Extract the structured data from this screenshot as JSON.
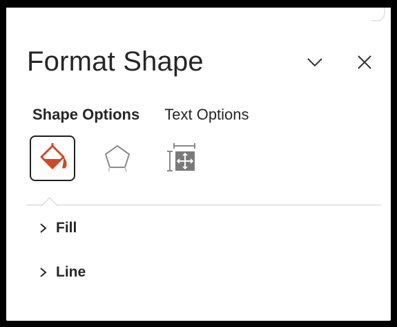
{
  "pane": {
    "title": "Format Shape",
    "icons": {
      "collapse": "chevron-down-icon",
      "close": "close-icon"
    }
  },
  "tabs": [
    {
      "label": "Shape Options",
      "active": true
    },
    {
      "label": "Text Options",
      "active": false
    }
  ],
  "icon_tabs": [
    {
      "name": "fill-line-icon",
      "selected": true
    },
    {
      "name": "effects-icon",
      "selected": false
    },
    {
      "name": "size-properties-icon",
      "selected": false
    }
  ],
  "sections": [
    {
      "label": "Fill",
      "icon": "chevron-right-icon"
    },
    {
      "label": "Line",
      "icon": "chevron-right-icon"
    }
  ],
  "colors": {
    "accent": "#d24726",
    "text": "#262626",
    "border": "#1f1f1f"
  }
}
